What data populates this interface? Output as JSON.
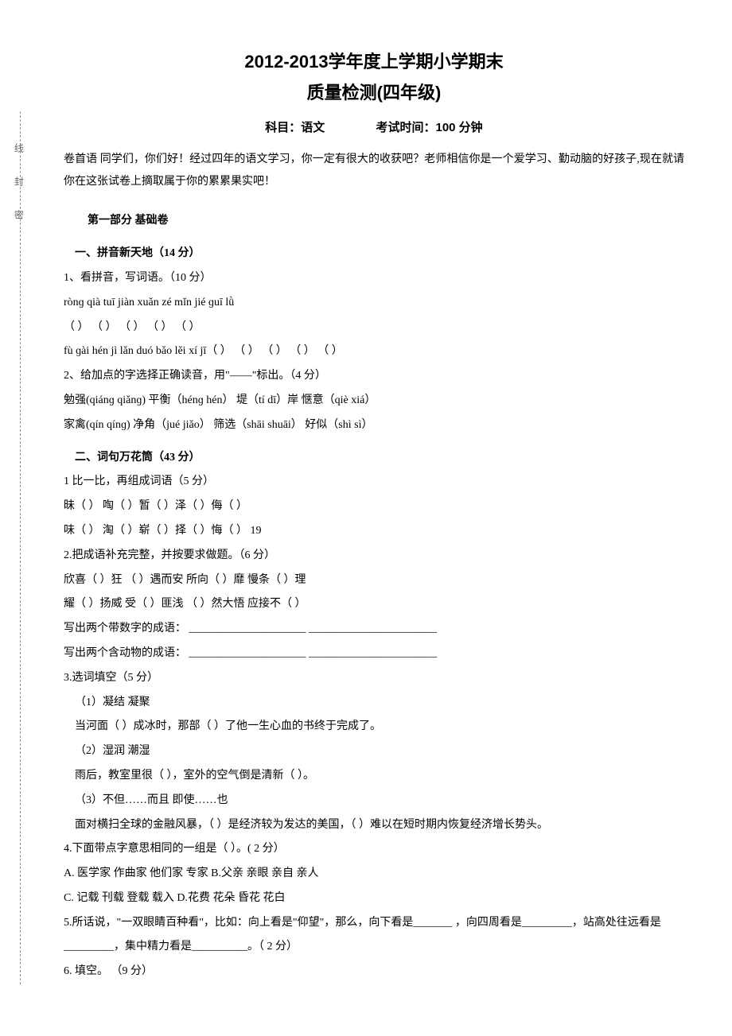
{
  "title1": "2012-2013学年度上学期小学期末",
  "title2": "质量检测(四年级)",
  "meta": {
    "subject": "科目：语文",
    "time": "考试时间：100 分钟"
  },
  "preface": "卷首语 同学们，你们好！经过四年的语文学习，你一定有很大的收获吧？老师相信你是一个爱学习、勤动脑的好孩子,现在就请你在这张试卷上摘取属于你的累累果实吧！",
  "part1": "第一部分 基础卷",
  "q1": {
    "header": "一、拼音新天地（14 分）",
    "sub1": "1、看拼音，写词语。（10 分）",
    "pinyin1": " rònɡ   qià    tuī   jiàn     xuǎn   zé     mǐn   jié     ɡuī   lǜ",
    "blanks1": "（          ） （          ） （          ） （          ） （             ）",
    "pinyin2": " fù    ɡài     hén   jì      lǎn   duó     bǎo  lěi     xí    jī（          ）  （          ） （          ）  （          ）  （            ）",
    "sub2": " 2、给加点的字选择正确读音，用\"——\"标出。（4 分）",
    "line2a": " 勉强(qiánɡ qiǎnɡ)   平衡（hénɡ hén）    堤（tí dī）岸      惬意（qiè  xiá）",
    "line2b": " 家禽(qín   qínɡ)   净角（jué jiǎo）   筛选（shāi shuāi）   好似（shì  sì）"
  },
  "q2": {
    "header": "二、词句万花筒（43 分）",
    "sub1": " 1 比一比，再组成词语（5 分）",
    "line1a": " 昧（        ） 啕（        ）暂（        ）泽（        ）侮（        ）",
    "line1b": " 味（        ） 淘（        ）崭（        ）择（        ）悔（        ）  19",
    "sub2": "2.把成语补充完整，并按要求做题。（6 分）",
    "line2a": "欣喜（   ）狂   （   ）遇而安   所向（   ）靡   慢条（   ）理",
    "line2b": "耀（   ）扬威   受（   ）匪浅   （   ）然大悟   应接不（    ）",
    "line2c": "写出两个带数字的成语：   _____________________     _______________________",
    "line2d": "写出两个含动物的成语：   _____________________     _______________________",
    "sub3": " 3.选词填空（5 分）",
    "l3_1": "  （1）凝结    凝聚",
    "l3_2": "   当河面（        ）成冰时，那部（       ）了他一生心血的书终于完成了。",
    "l3_3": "  （2）湿润    潮湿",
    "l3_4": "   雨后，教室里很（          ），室外的空气倒是清新（        ）。",
    "l3_5": "  （3）不但……而且     即使……也",
    "l3_6": "  面对横扫全球的金融风暴，（       ）是经济较为发达的美国，（       ）难以在短时期内恢复经济增长势头。",
    "sub4": " 4.下面带点字意思相同的一组是（    ）。( 2 分）",
    "l4a": " A.   医学家   作曲家   他们家   专家        B.父亲   亲眼   亲自   亲人",
    "l4b": " C.   记载   刊载   登载   载入            D.花费   花朵   昏花   花白",
    "sub5": " 5.所话说，\"一双眼睛百种看\"，比如：向上看是\"仰望\"，那么，向下看是_______ ，向四周看是_________，站高处往远看是_________，集中精力看是__________。（ 2 分）",
    "sub6": " 6. 填空。 （9 分）"
  },
  "side": "线   封   密"
}
